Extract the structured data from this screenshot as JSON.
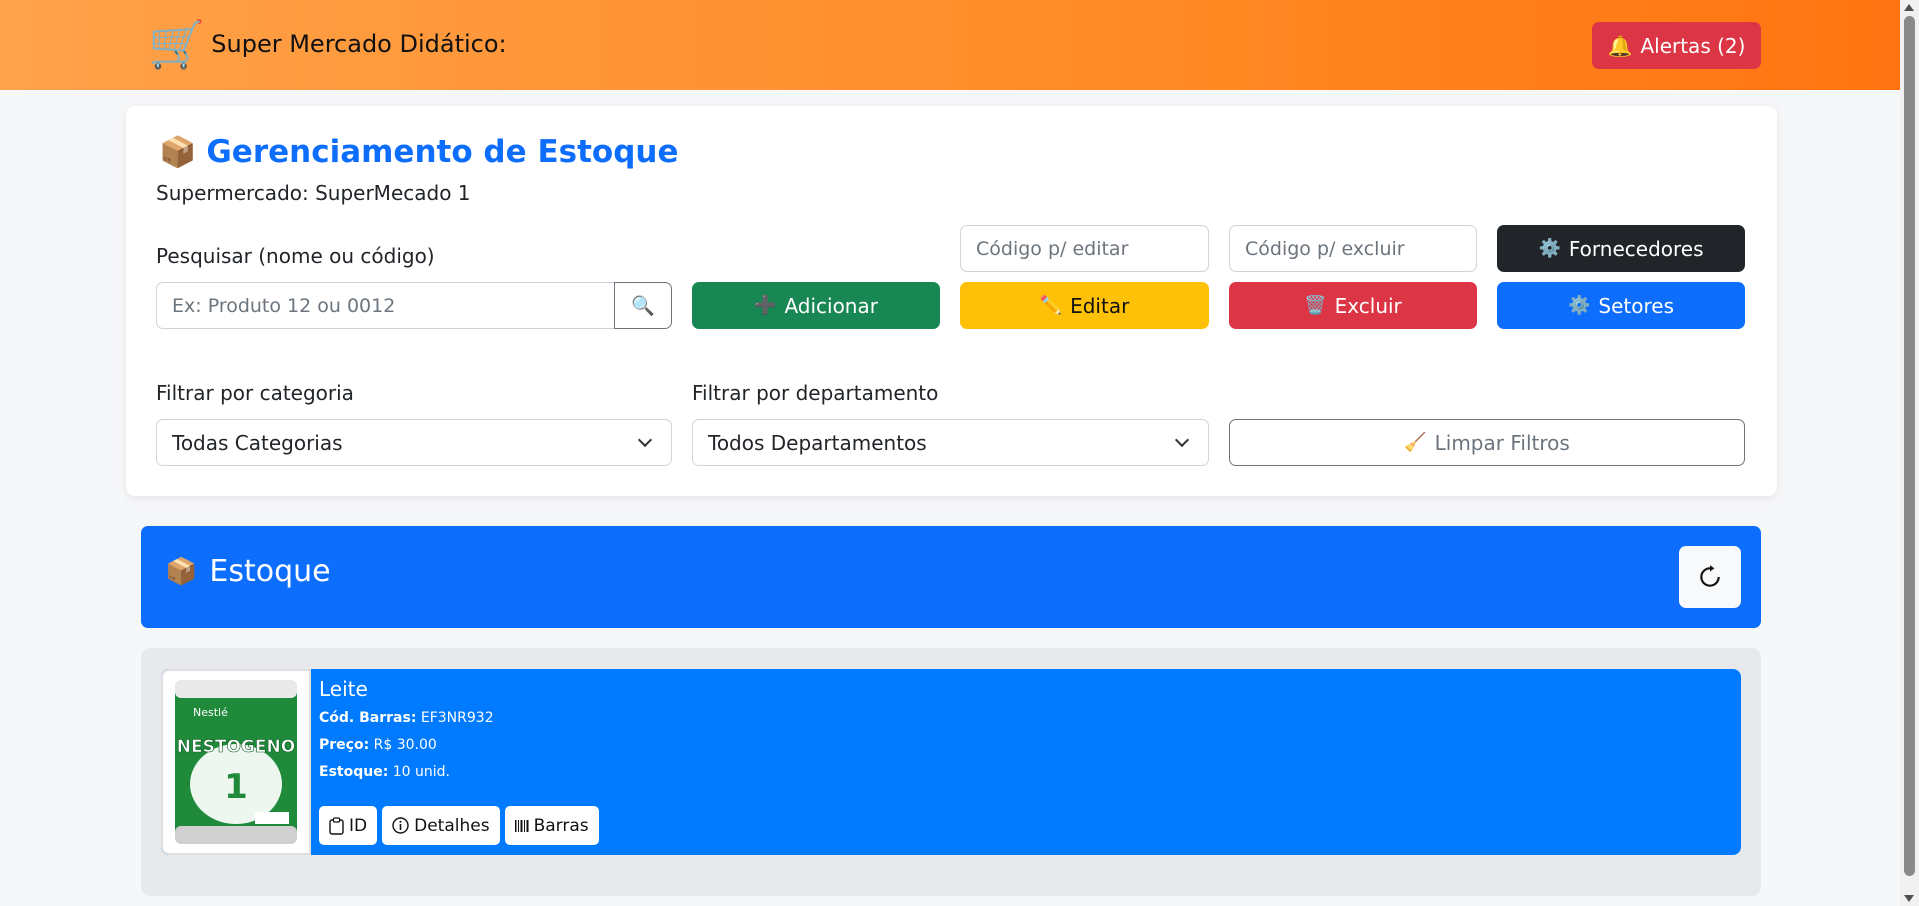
{
  "header": {
    "title": "Super Mercado Didático:",
    "cart_icon": "🛒",
    "alerts_label": "Alertas (2)",
    "alerts_icon": "🔔"
  },
  "management": {
    "title": "Gerenciamento de Estoque",
    "title_icon": "📦",
    "store_label": "Supermercado: SuperMecado 1",
    "search_label": "Pesquisar (nome ou código)",
    "search_placeholder": "Ex: Produto 12 ou 0012",
    "search_icon": "🔍",
    "edit_code_placeholder": "Código p/ editar",
    "delete_code_placeholder": "Código p/ excluir",
    "buttons": {
      "add": "Adicionar",
      "add_icon": "➕",
      "edit": "Editar",
      "edit_icon": "✏️",
      "delete": "Excluir",
      "delete_icon": "🗑️",
      "suppliers": "Fornecedores",
      "suppliers_icon": "⚙️",
      "sectors": "Setores",
      "sectors_icon": "⚙️",
      "clear_filters": "Limpar Filtros",
      "clear_icon": "🧹"
    },
    "category_filter_label": "Filtrar por categoria",
    "category_selected": "Todas Categorias",
    "department_filter_label": "Filtrar por departamento",
    "department_selected": "Todos Departamentos"
  },
  "stock": {
    "title": "Estoque",
    "title_icon": "📦",
    "products": [
      {
        "name": "Leite",
        "barcode_label": "Cód. Barras:",
        "barcode": "EF3NR932",
        "price_label": "Preço:",
        "price": "R$ 30.00",
        "stock_label": "Estoque:",
        "stock": "10 unid.",
        "image_text": "NESTOGENO",
        "image_brand": "Nestlé",
        "image_number": "1",
        "actions": {
          "id": "ID",
          "details": "Detalhes",
          "barcode": "Barras"
        }
      }
    ]
  },
  "colors": {
    "header_gradient_start": "#ffa24a",
    "header_gradient_end": "#ff7411",
    "primary": "#0d6efd",
    "product_card": "#007bff",
    "success": "#198754",
    "warning": "#ffc107",
    "danger": "#dc3545",
    "dark": "#212529"
  }
}
